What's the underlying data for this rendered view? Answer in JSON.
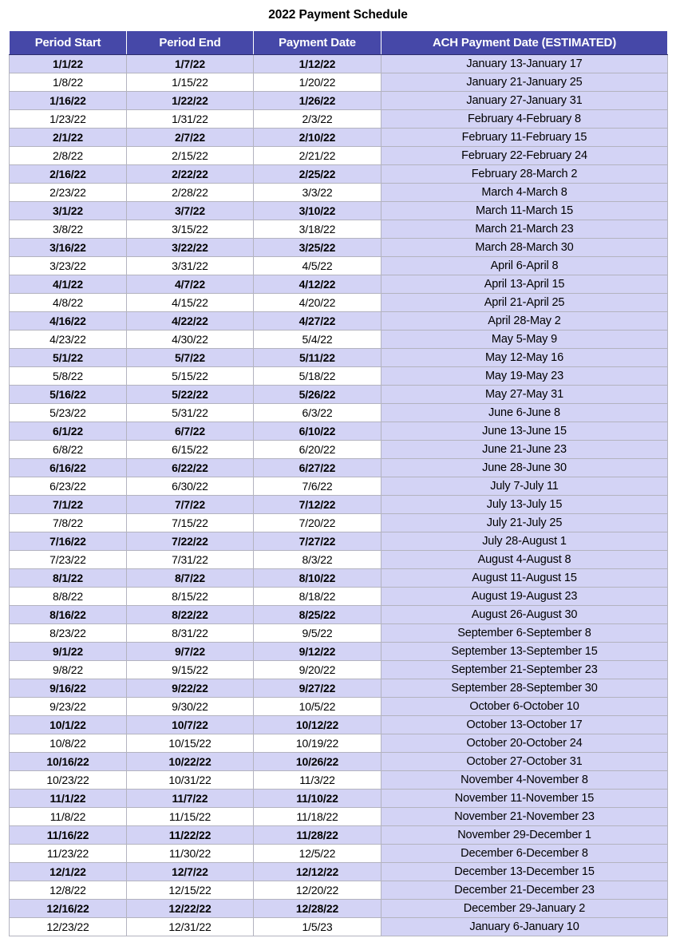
{
  "document": {
    "title": "2022 Payment Schedule"
  },
  "colors": {
    "header_background": "#4648A8",
    "header_text": "#FFFFFF",
    "row_shaded": "#D3D3F5",
    "row_plain": "#FFFFFF",
    "ach_column_background": "#D3D3F5",
    "grid_line": "#B3B3BF",
    "body_text": "#000000"
  },
  "table": {
    "columns": [
      {
        "key": "period_start",
        "label": "Period Start"
      },
      {
        "key": "period_end",
        "label": "Period End"
      },
      {
        "key": "payment_date",
        "label": "Payment Date"
      },
      {
        "key": "ach_payment_date",
        "label": "ACH Payment Date (ESTIMATED)"
      }
    ],
    "rows": [
      {
        "period_start": "1/1/22",
        "period_end": "1/7/22",
        "payment_date": "1/12/22",
        "ach_payment_date": "January 13-January 17",
        "shaded": true
      },
      {
        "period_start": "1/8/22",
        "period_end": "1/15/22",
        "payment_date": "1/20/22",
        "ach_payment_date": "January 21-January 25",
        "shaded": false
      },
      {
        "period_start": "1/16/22",
        "period_end": "1/22/22",
        "payment_date": "1/26/22",
        "ach_payment_date": "January 27-January 31",
        "shaded": true
      },
      {
        "period_start": "1/23/22",
        "period_end": "1/31/22",
        "payment_date": "2/3/22",
        "ach_payment_date": "February 4-February 8",
        "shaded": false
      },
      {
        "period_start": "2/1/22",
        "period_end": "2/7/22",
        "payment_date": "2/10/22",
        "ach_payment_date": "February 11-February 15",
        "shaded": true
      },
      {
        "period_start": "2/8/22",
        "period_end": "2/15/22",
        "payment_date": "2/21/22",
        "ach_payment_date": "February 22-February 24",
        "shaded": false
      },
      {
        "period_start": "2/16/22",
        "period_end": "2/22/22",
        "payment_date": "2/25/22",
        "ach_payment_date": "February 28-March 2",
        "shaded": true
      },
      {
        "period_start": "2/23/22",
        "period_end": "2/28/22",
        "payment_date": "3/3/22",
        "ach_payment_date": "March 4-March 8",
        "shaded": false
      },
      {
        "period_start": "3/1/22",
        "period_end": "3/7/22",
        "payment_date": "3/10/22",
        "ach_payment_date": "March 11-March 15",
        "shaded": true
      },
      {
        "period_start": "3/8/22",
        "period_end": "3/15/22",
        "payment_date": "3/18/22",
        "ach_payment_date": "March 21-March 23",
        "shaded": false
      },
      {
        "period_start": "3/16/22",
        "period_end": "3/22/22",
        "payment_date": "3/25/22",
        "ach_payment_date": "March 28-March 30",
        "shaded": true
      },
      {
        "period_start": "3/23/22",
        "period_end": "3/31/22",
        "payment_date": "4/5/22",
        "ach_payment_date": "April 6-April 8",
        "shaded": false
      },
      {
        "period_start": "4/1/22",
        "period_end": "4/7/22",
        "payment_date": "4/12/22",
        "ach_payment_date": "April 13-April 15",
        "shaded": true
      },
      {
        "period_start": "4/8/22",
        "period_end": "4/15/22",
        "payment_date": "4/20/22",
        "ach_payment_date": "April 21-April 25",
        "shaded": false
      },
      {
        "period_start": "4/16/22",
        "period_end": "4/22/22",
        "payment_date": "4/27/22",
        "ach_payment_date": "April 28-May 2",
        "shaded": true
      },
      {
        "period_start": "4/23/22",
        "period_end": "4/30/22",
        "payment_date": "5/4/22",
        "ach_payment_date": "May 5-May 9",
        "shaded": false
      },
      {
        "period_start": "5/1/22",
        "period_end": "5/7/22",
        "payment_date": "5/11/22",
        "ach_payment_date": "May 12-May 16",
        "shaded": true
      },
      {
        "period_start": "5/8/22",
        "period_end": "5/15/22",
        "payment_date": "5/18/22",
        "ach_payment_date": "May 19-May 23",
        "shaded": false
      },
      {
        "period_start": "5/16/22",
        "period_end": "5/22/22",
        "payment_date": "5/26/22",
        "ach_payment_date": "May 27-May 31",
        "shaded": true
      },
      {
        "period_start": "5/23/22",
        "period_end": "5/31/22",
        "payment_date": "6/3/22",
        "ach_payment_date": "June 6-June 8",
        "shaded": false
      },
      {
        "period_start": "6/1/22",
        "period_end": "6/7/22",
        "payment_date": "6/10/22",
        "ach_payment_date": "June 13-June 15",
        "shaded": true
      },
      {
        "period_start": "6/8/22",
        "period_end": "6/15/22",
        "payment_date": "6/20/22",
        "ach_payment_date": "June 21-June 23",
        "shaded": false
      },
      {
        "period_start": "6/16/22",
        "period_end": "6/22/22",
        "payment_date": "6/27/22",
        "ach_payment_date": "June 28-June 30",
        "shaded": true
      },
      {
        "period_start": "6/23/22",
        "period_end": "6/30/22",
        "payment_date": "7/6/22",
        "ach_payment_date": "July 7-July 11",
        "shaded": false
      },
      {
        "period_start": "7/1/22",
        "period_end": "7/7/22",
        "payment_date": "7/12/22",
        "ach_payment_date": "July 13-July 15",
        "shaded": true
      },
      {
        "period_start": "7/8/22",
        "period_end": "7/15/22",
        "payment_date": "7/20/22",
        "ach_payment_date": "July 21-July 25",
        "shaded": false
      },
      {
        "period_start": "7/16/22",
        "period_end": "7/22/22",
        "payment_date": "7/27/22",
        "ach_payment_date": "July 28-August 1",
        "shaded": true
      },
      {
        "period_start": "7/23/22",
        "period_end": "7/31/22",
        "payment_date": "8/3/22",
        "ach_payment_date": "August 4-August 8",
        "shaded": false
      },
      {
        "period_start": "8/1/22",
        "period_end": "8/7/22",
        "payment_date": "8/10/22",
        "ach_payment_date": "August 11-August 15",
        "shaded": true
      },
      {
        "period_start": "8/8/22",
        "period_end": "8/15/22",
        "payment_date": "8/18/22",
        "ach_payment_date": "August 19-August 23",
        "shaded": false
      },
      {
        "period_start": "8/16/22",
        "period_end": "8/22/22",
        "payment_date": "8/25/22",
        "ach_payment_date": "August 26-August 30",
        "shaded": true
      },
      {
        "period_start": "8/23/22",
        "period_end": "8/31/22",
        "payment_date": "9/5/22",
        "ach_payment_date": "September 6-September 8",
        "shaded": false
      },
      {
        "period_start": "9/1/22",
        "period_end": "9/7/22",
        "payment_date": "9/12/22",
        "ach_payment_date": "September 13-September 15",
        "shaded": true
      },
      {
        "period_start": "9/8/22",
        "period_end": "9/15/22",
        "payment_date": "9/20/22",
        "ach_payment_date": "September 21-September 23",
        "shaded": false
      },
      {
        "period_start": "9/16/22",
        "period_end": "9/22/22",
        "payment_date": "9/27/22",
        "ach_payment_date": "September 28-September 30",
        "shaded": true
      },
      {
        "period_start": "9/23/22",
        "period_end": "9/30/22",
        "payment_date": "10/5/22",
        "ach_payment_date": "October 6-October 10",
        "shaded": false
      },
      {
        "period_start": "10/1/22",
        "period_end": "10/7/22",
        "payment_date": "10/12/22",
        "ach_payment_date": "October 13-October 17",
        "shaded": true
      },
      {
        "period_start": "10/8/22",
        "period_end": "10/15/22",
        "payment_date": "10/19/22",
        "ach_payment_date": "October 20-October 24",
        "shaded": false
      },
      {
        "period_start": "10/16/22",
        "period_end": "10/22/22",
        "payment_date": "10/26/22",
        "ach_payment_date": "October 27-October 31",
        "shaded": true
      },
      {
        "period_start": "10/23/22",
        "period_end": "10/31/22",
        "payment_date": "11/3/22",
        "ach_payment_date": "November 4-November 8",
        "shaded": false
      },
      {
        "period_start": "11/1/22",
        "period_end": "11/7/22",
        "payment_date": "11/10/22",
        "ach_payment_date": "November 11-November 15",
        "shaded": true
      },
      {
        "period_start": "11/8/22",
        "period_end": "11/15/22",
        "payment_date": "11/18/22",
        "ach_payment_date": "November 21-November 23",
        "shaded": false
      },
      {
        "period_start": "11/16/22",
        "period_end": "11/22/22",
        "payment_date": "11/28/22",
        "ach_payment_date": "November 29-December 1",
        "shaded": true
      },
      {
        "period_start": "11/23/22",
        "period_end": "11/30/22",
        "payment_date": "12/5/22",
        "ach_payment_date": "December 6-December 8",
        "shaded": false
      },
      {
        "period_start": "12/1/22",
        "period_end": "12/7/22",
        "payment_date": "12/12/22",
        "ach_payment_date": "December 13-December 15",
        "shaded": true
      },
      {
        "period_start": "12/8/22",
        "period_end": "12/15/22",
        "payment_date": "12/20/22",
        "ach_payment_date": "December 21-December 23",
        "shaded": false
      },
      {
        "period_start": "12/16/22",
        "period_end": "12/22/22",
        "payment_date": "12/28/22",
        "ach_payment_date": "December 29-January 2",
        "shaded": true
      },
      {
        "period_start": "12/23/22",
        "period_end": "12/31/22",
        "payment_date": "1/5/23",
        "ach_payment_date": "January 6-January 10",
        "shaded": false
      }
    ]
  }
}
